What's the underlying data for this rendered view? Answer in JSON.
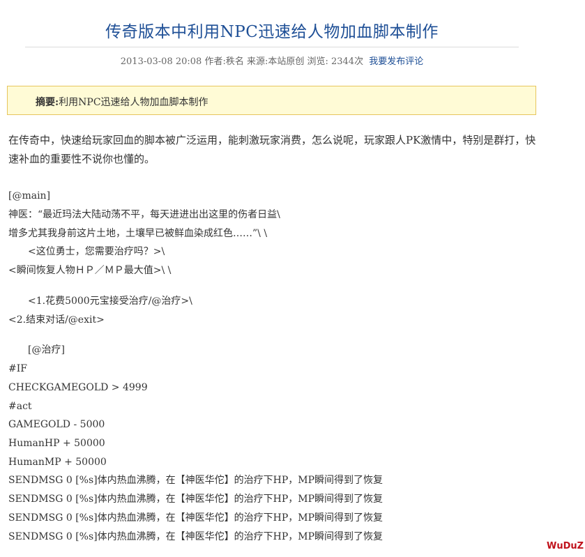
{
  "article": {
    "title": "传奇版本中利用NPC迅速给人物加血脚本制作",
    "meta": {
      "info": "2013-03-08 20:08 作者:秩名 来源:本站原创 浏览: 2344次",
      "comment_link": "我要发布评论"
    },
    "summary": {
      "label": "摘要:",
      "text": "利用NPC迅速给人物加血脚本制作"
    },
    "intro": "在传奇中，快速给玩家回血的脚本被广泛运用，能刺激玩家消费，怎么说呢，玩家跟人PK激情中，特别是群打，快速补血的重要性不说你也懂的。",
    "code": [
      "[@main]",
      "神医：“最近玛法大陆动荡不平，每天进进出出这里的伤者日益\\",
      "增多尤其我身前这片土地，土壤早已被鲜血染成红色……”\\ \\",
      "<这位勇士，您需要治疗吗？>\\",
      "<瞬间恢复人物ＨＰ／ＭＰ最大值>\\ \\",
      "<1.花费5000元宝接受治疗/@治疗>\\",
      "<2.结束对话/@exit>",
      "[@治疗]",
      "#IF",
      "CHECKGAMEGOLD > 4999",
      "#act",
      "GAMEGOLD - 5000",
      "HumanHP + 50000",
      "HumanMP + 50000",
      "SENDMSG 0 [%s]体内热血沸腾，在【神医华佗】的治疗下HP，MP瞬间得到了恢复",
      "SENDMSG 0 [%s]体内热血沸腾，在【神医华佗】的治疗下HP，MP瞬间得到了恢复",
      "SENDMSG 0 [%s]体内热血沸腾，在【神医华佗】的治疗下HP，MP瞬间得到了恢复",
      "SENDMSG 0 [%s]体内热血沸腾，在【神医华佗】的治疗下HP，MP瞬间得到了恢复"
    ]
  },
  "watermark": "WuDuZ"
}
